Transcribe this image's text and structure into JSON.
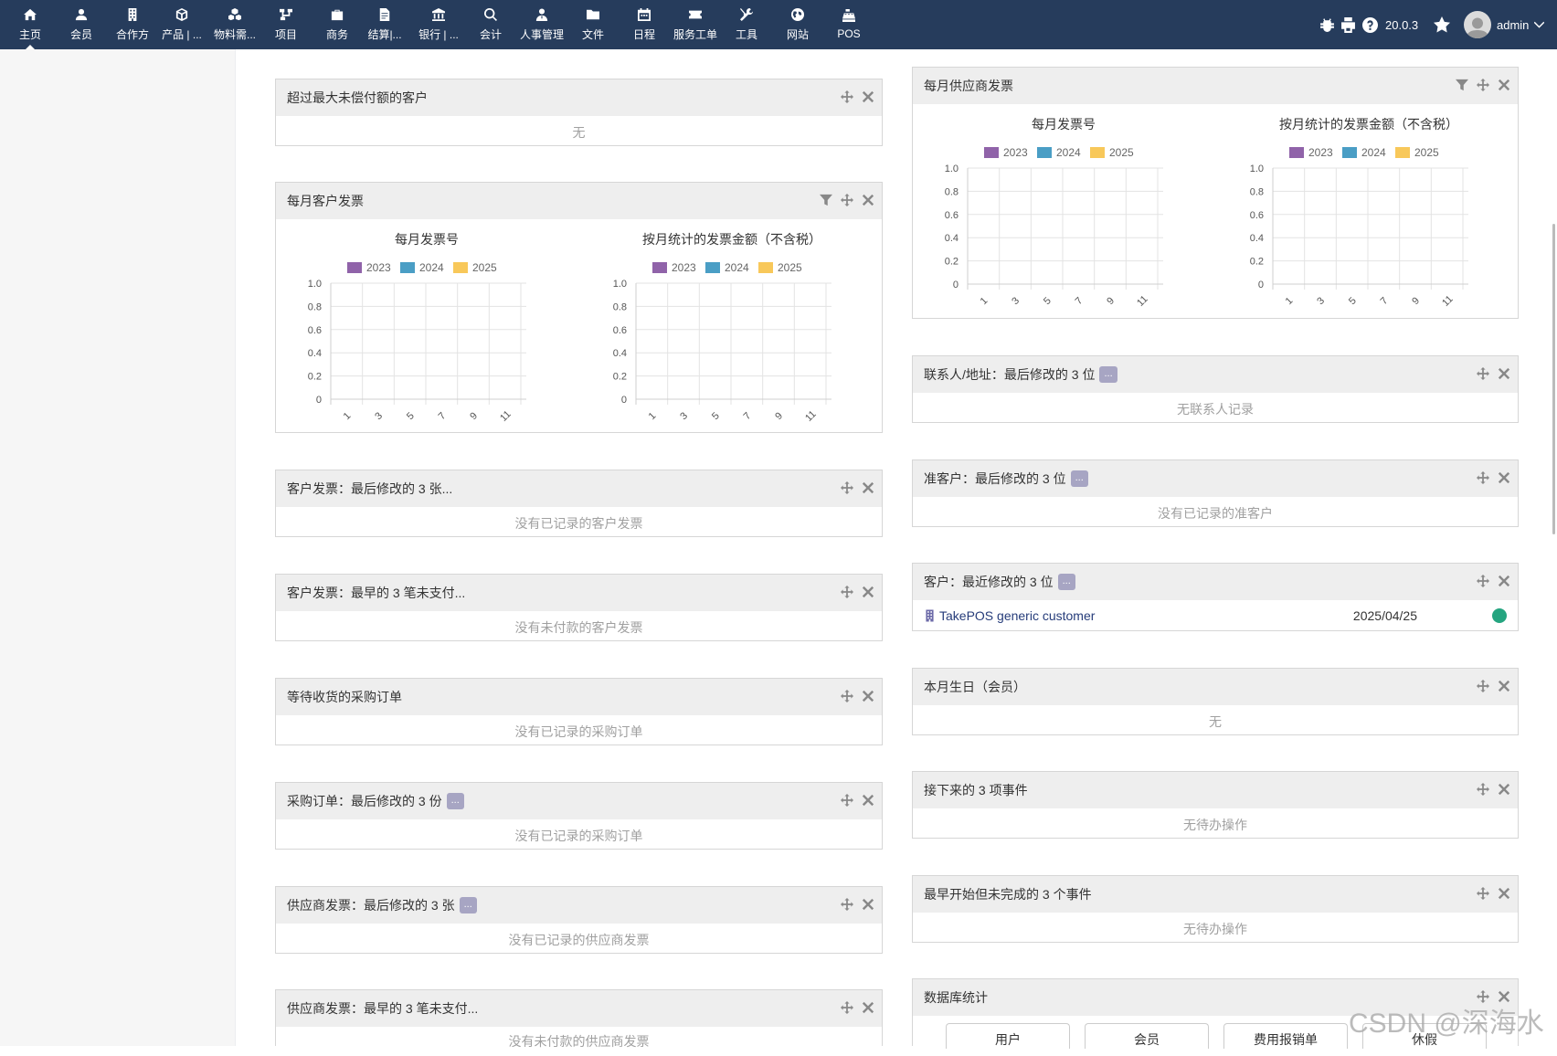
{
  "nav": {
    "items": [
      {
        "label": "主页",
        "icon": "home-icon"
      },
      {
        "label": "会员",
        "icon": "user-icon"
      },
      {
        "label": "合作方",
        "icon": "building-icon"
      },
      {
        "label": "产品 | ...",
        "icon": "cube-icon"
      },
      {
        "label": "物料需...",
        "icon": "cubes-icon"
      },
      {
        "label": "项目",
        "icon": "sitemap-icon"
      },
      {
        "label": "商务",
        "icon": "suitcase-icon"
      },
      {
        "label": "结算|...",
        "icon": "file-invoice-icon"
      },
      {
        "label": "银行 | ...",
        "icon": "bank-icon"
      },
      {
        "label": "会计",
        "icon": "search-dollar-icon"
      },
      {
        "label": "人事管理",
        "icon": "user-tie-icon"
      },
      {
        "label": "文件",
        "icon": "folder-icon"
      },
      {
        "label": "日程",
        "icon": "calendar-icon"
      },
      {
        "label": "服务工单",
        "icon": "ticket-icon"
      },
      {
        "label": "工具",
        "icon": "tools-icon"
      },
      {
        "label": "网站",
        "icon": "globe-icon"
      },
      {
        "label": "POS",
        "icon": "cash-register-icon"
      }
    ],
    "version": "20.0.3",
    "user": "admin"
  },
  "widgets": {
    "overdue": {
      "title": "超过最大未偿付额的客户",
      "empty": "无"
    },
    "cust_monthly": {
      "title": "每月客户发票"
    },
    "supp_monthly": {
      "title": "每月供应商发票"
    },
    "cust_last": {
      "title": "客户发票：最后修改的 3 张...",
      "empty": "没有已记录的客户发票"
    },
    "cust_unpaid": {
      "title": "客户发票：最早的 3 笔未支付...",
      "empty": "没有未付款的客户发票"
    },
    "po_waiting": {
      "title": "等待收货的采购订单",
      "empty": "没有已记录的采购订单"
    },
    "po_last": {
      "title": "采购订单：最后修改的 3 份",
      "more": "...",
      "empty": "没有已记录的采购订单"
    },
    "supp_last": {
      "title": "供应商发票：最后修改的 3 张",
      "more": "...",
      "empty": "没有已记录的供应商发票"
    },
    "supp_unpaid": {
      "title": "供应商发票：最早的 3 笔未支付...",
      "empty": "没有未付款的供应商发票"
    },
    "contacts": {
      "title": "联系人/地址：最后修改的 3 位",
      "more": "...",
      "empty": "无联系人记录"
    },
    "prospects": {
      "title": "准客户：最后修改的 3 位",
      "more": "...",
      "empty": "没有已记录的准客户"
    },
    "customers": {
      "title": "客户：最近修改的 3 位",
      "more": "...",
      "row": {
        "name": "TakePOS generic customer",
        "date": "2025/04/25"
      }
    },
    "birthdays": {
      "title": "本月生日（会员）",
      "empty": "无"
    },
    "next_events": {
      "title": "接下来的 3 项事件",
      "empty": "无待办操作"
    },
    "late_events": {
      "title": "最早开始但未完成的 3 个事件",
      "empty": "无待办操作"
    },
    "dbstats": {
      "title": "数据库统计",
      "tabs": [
        "用户",
        "会员",
        "费用报销单",
        "休假"
      ]
    }
  },
  "chart_data": [
    {
      "type": "bar",
      "panel": "每月客户发票",
      "title": "每月发票号",
      "legend": [
        "2023",
        "2024",
        "2025"
      ],
      "colors": [
        "#9063a9",
        "#4a9ec5",
        "#f8c85a"
      ],
      "yticks": [
        "1.0",
        "0.8",
        "0.6",
        "0.4",
        "0.2",
        "0"
      ],
      "xticks": [
        "1",
        "3",
        "5",
        "7",
        "9",
        "11"
      ],
      "ylim": [
        0,
        1
      ],
      "series": []
    },
    {
      "type": "bar",
      "panel": "每月客户发票",
      "title": "按月统计的发票金额（不含税）",
      "legend": [
        "2023",
        "2024",
        "2025"
      ],
      "colors": [
        "#9063a9",
        "#4a9ec5",
        "#f8c85a"
      ],
      "yticks": [
        "1.0",
        "0.8",
        "0.6",
        "0.4",
        "0.2",
        "0"
      ],
      "xticks": [
        "1",
        "3",
        "5",
        "7",
        "9",
        "11"
      ],
      "ylim": [
        0,
        1
      ],
      "series": []
    },
    {
      "type": "bar",
      "panel": "每月供应商发票",
      "title": "每月发票号",
      "legend": [
        "2023",
        "2024",
        "2025"
      ],
      "colors": [
        "#9063a9",
        "#4a9ec5",
        "#f8c85a"
      ],
      "yticks": [
        "1.0",
        "0.8",
        "0.6",
        "0.4",
        "0.2",
        "0"
      ],
      "xticks": [
        "1",
        "3",
        "5",
        "7",
        "9",
        "11"
      ],
      "ylim": [
        0,
        1
      ],
      "series": []
    },
    {
      "type": "bar",
      "panel": "每月供应商发票",
      "title": "按月统计的发票金额（不含税）",
      "legend": [
        "2023",
        "2024",
        "2025"
      ],
      "colors": [
        "#9063a9",
        "#4a9ec5",
        "#f8c85a"
      ],
      "yticks": [
        "1.0",
        "0.8",
        "0.6",
        "0.4",
        "0.2",
        "0"
      ],
      "xticks": [
        "1",
        "3",
        "5",
        "7",
        "9",
        "11"
      ],
      "ylim": [
        0,
        1
      ],
      "series": []
    }
  ],
  "watermark": "CSDN @深海水"
}
